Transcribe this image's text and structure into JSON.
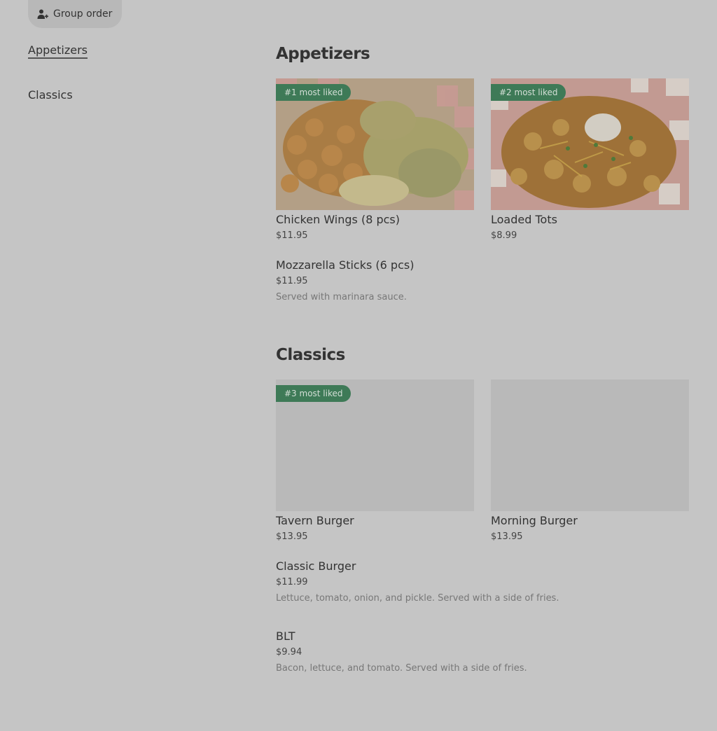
{
  "header": {
    "group_order_label": "Group order",
    "group_order_icon": "add-person-icon"
  },
  "nav": {
    "items": [
      {
        "label": "Appetizers",
        "active": true
      },
      {
        "label": "Classics",
        "active": false
      }
    ]
  },
  "sections": [
    {
      "title": "Appetizers",
      "cards": [
        {
          "name": "Chicken Wings (8 pcs)",
          "price": "$11.95",
          "badge": "#1 most liked"
        },
        {
          "name": "Loaded Tots",
          "price": "$8.99",
          "badge": "#2 most liked"
        }
      ],
      "rows": [
        {
          "name": "Mozzarella Sticks (6 pcs)",
          "price": "$11.95",
          "desc": "Served with marinara sauce."
        }
      ]
    },
    {
      "title": "Classics",
      "cards": [
        {
          "name": "Tavern Burger",
          "price": "$13.95",
          "badge": "#3 most liked"
        },
        {
          "name": "Morning Burger",
          "price": "$13.95",
          "badge": ""
        }
      ],
      "rows": [
        {
          "name": "Classic Burger",
          "price": "$11.99",
          "desc": "Lettuce, tomato, onion, and pickle. Served with a side of fries."
        },
        {
          "name": "BLT",
          "price": "$9.94",
          "desc": "Bacon, lettuce, and tomato. Served with a side of fries."
        }
      ]
    }
  ],
  "colors": {
    "badge_bg": "#3e7a57",
    "overlay": "#c5c5c5"
  }
}
